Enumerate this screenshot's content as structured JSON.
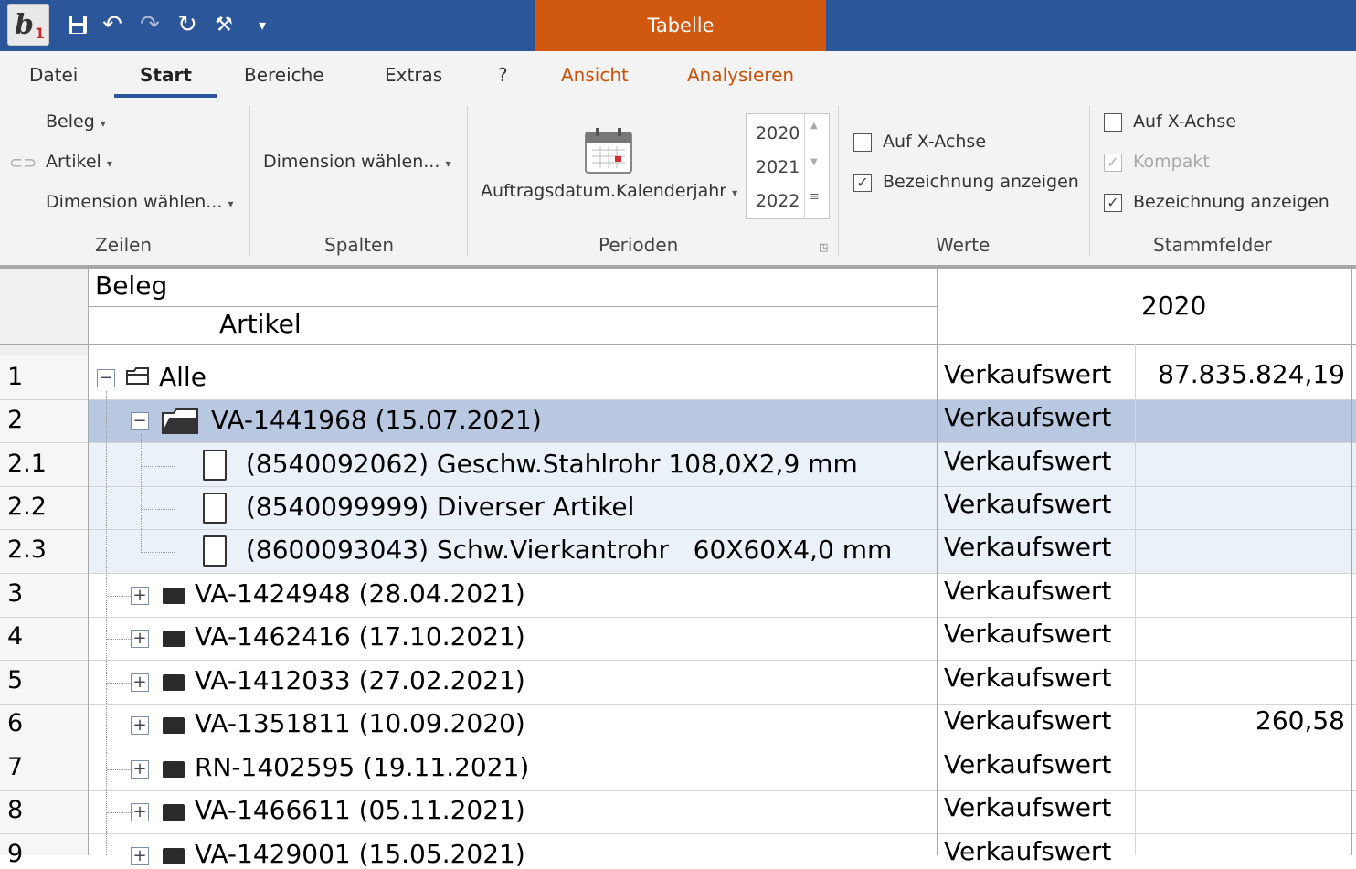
{
  "app": {
    "context_tab": "Tabelle"
  },
  "menu": {
    "tabs": [
      "Datei",
      "Start",
      "Bereiche",
      "Extras",
      "?",
      "Ansicht",
      "Analysieren"
    ],
    "active": "Start"
  },
  "ribbon": {
    "zeilen": {
      "items": [
        "Beleg",
        "Artikel",
        "Dimension wählen..."
      ],
      "label": "Zeilen"
    },
    "spalten": {
      "dimension": "Dimension wählen...",
      "label": "Spalten"
    },
    "perioden": {
      "period_field": "Auftragsdatum.Kalenderjahr",
      "years": [
        "2020",
        "2021",
        "2022"
      ],
      "label": "Perioden"
    },
    "werte": {
      "x_axis": "Auf X-Achse",
      "x_axis_checked": false,
      "show_desc": "Bezeichnung anzeigen",
      "show_desc_checked": true,
      "label": "Werte"
    },
    "stammfelder": {
      "x_axis": "Auf X-Achse",
      "x_axis_checked": false,
      "compact": "Kompakt",
      "compact_checked": true,
      "show_desc": "Bezeichnung anzeigen",
      "show_desc_checked": true,
      "label": "Stammfelder"
    }
  },
  "grid": {
    "header": {
      "level1": "Beleg",
      "level2": "Artikel",
      "year": "2020"
    },
    "rows": [
      {
        "num": "1",
        "label": "Alle",
        "measure": "Verkaufswert",
        "value": "87.835.824,19"
      },
      {
        "num": "2",
        "label": "VA-1441968 (15.07.2021)",
        "measure": "Verkaufswert",
        "value": ""
      },
      {
        "num": "2.1",
        "label": "(8540092062) Geschw.Stahlrohr 108,0X2,9 mm",
        "measure": "Verkaufswert",
        "value": ""
      },
      {
        "num": "2.2",
        "label": "(8540099999) Diverser Artikel",
        "measure": "Verkaufswert",
        "value": ""
      },
      {
        "num": "2.3",
        "label": "(8600093043) Schw.Vierkantrohr   60X60X4,0 mm",
        "measure": "Verkaufswert",
        "value": ""
      },
      {
        "num": "3",
        "label": "VA-1424948 (28.04.2021)",
        "measure": "Verkaufswert",
        "value": ""
      },
      {
        "num": "4",
        "label": "VA-1462416 (17.10.2021)",
        "measure": "Verkaufswert",
        "value": ""
      },
      {
        "num": "5",
        "label": "VA-1412033 (27.02.2021)",
        "measure": "Verkaufswert",
        "value": ""
      },
      {
        "num": "6",
        "label": "VA-1351811 (10.09.2020)",
        "measure": "Verkaufswert",
        "value": "260,58"
      },
      {
        "num": "7",
        "label": "RN-1402595 (19.11.2021)",
        "measure": "Verkaufswert",
        "value": ""
      },
      {
        "num": "8",
        "label": "VA-1466611 (05.11.2021)",
        "measure": "Verkaufswert",
        "value": ""
      },
      {
        "num": "9",
        "label": "VA-1429001 (15.05.2021)",
        "measure": "Verkaufswert",
        "value": ""
      }
    ]
  },
  "colors": {
    "titlebar": "#2b579a",
    "context_tab": "#d1590f",
    "selected_row": "#b7c8e0",
    "child_row": "#eaf1f8"
  }
}
